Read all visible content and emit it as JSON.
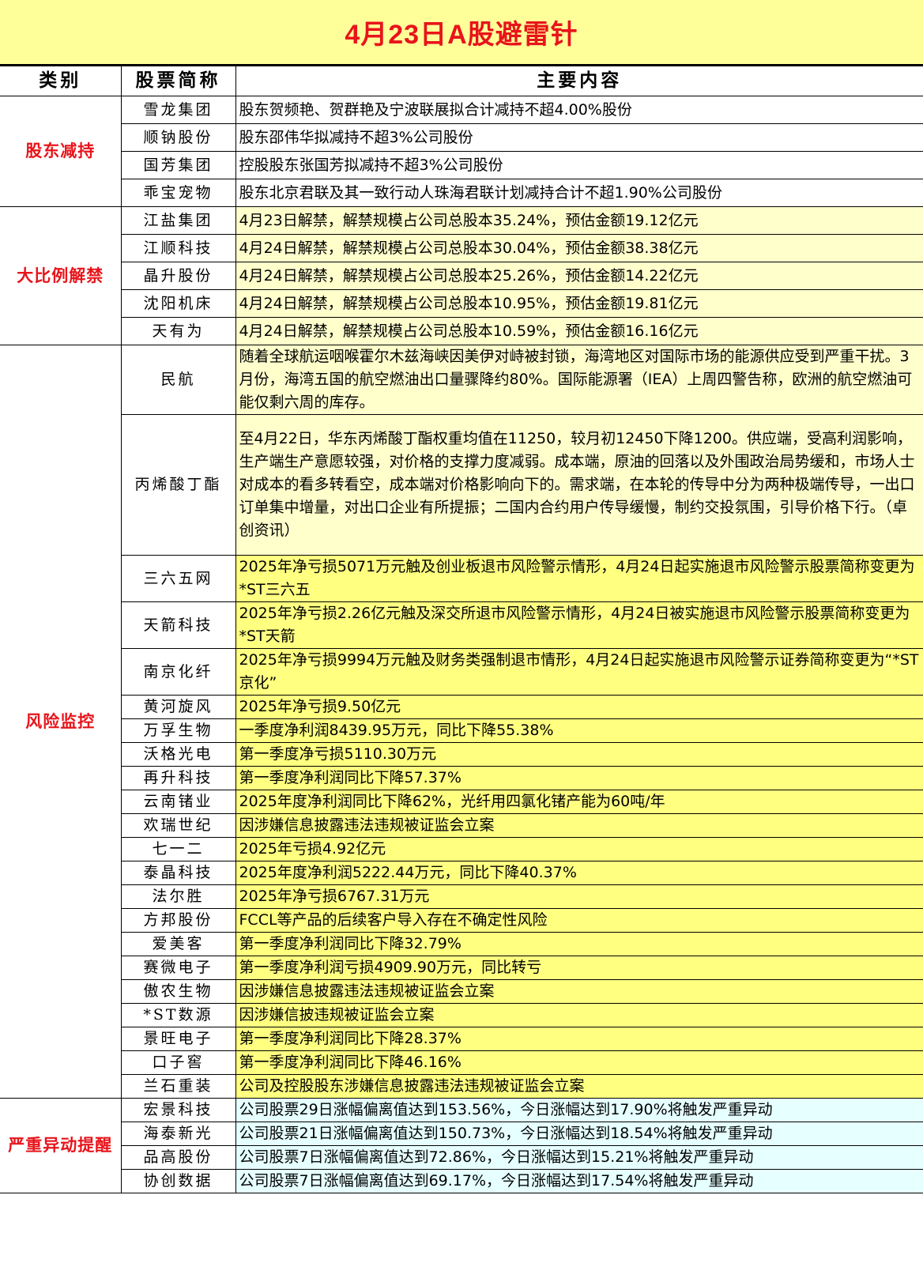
{
  "title": "4月23日A股避雷针",
  "headers": {
    "category": "类别",
    "stock": "股票简称",
    "content": "主要内容"
  },
  "groups": [
    {
      "category": "股东减持",
      "rows": [
        {
          "stock": "雪龙集团",
          "content": "股东贺频艳、贺群艳及宁波联展拟合计减持不超4.00%股份"
        },
        {
          "stock": "顺钠股份",
          "content": "股东邵伟华拟减持不超3%公司股份"
        },
        {
          "stock": "国芳集团",
          "content": "控股股东张国芳拟减持不超3%公司股份"
        },
        {
          "stock": "乖宝宠物",
          "content": "股东北京君联及其一致行动人珠海君联计划减持合计不超1.90%公司股份"
        }
      ]
    },
    {
      "category": "大比例解禁",
      "rows": [
        {
          "stock": "江盐集团",
          "content": "4月23日解禁，解禁规模占公司总股本35.24%，预估金额19.12亿元"
        },
        {
          "stock": "江顺科技",
          "content": "4月24日解禁，解禁规模占公司总股本30.04%，预估金额38.38亿元"
        },
        {
          "stock": "晶升股份",
          "content": "4月24日解禁，解禁规模占公司总股本25.26%，预估金额14.22亿元"
        },
        {
          "stock": "沈阳机床",
          "content": "4月24日解禁，解禁规模占公司总股本10.95%，预估金额19.81亿元"
        },
        {
          "stock": "天有为",
          "content": "4月24日解禁，解禁规模占公司总股本10.59%，预估金额16.16亿元"
        }
      ]
    },
    {
      "category": "风险监控",
      "rows": [
        {
          "stock": "民航",
          "content": "随着全球航运咽喉霍尔木兹海峡因美伊对峙被封锁，海湾地区对国际市场的能源供应受到严重干扰。3月份，海湾五国的航空燃油出口量骤降约80%。国际能源署（IEA）上周四警告称，欧洲的航空燃油可能仅剩六周的库存。"
        },
        {
          "stock": "丙烯酸丁酯",
          "content": "至4月22日，华东丙烯酸丁酯权重均值在11250，较月初12450下降1200。供应端，受高利润影响，生产端生产意愿较强，对价格的支撑力度减弱。成本端，原油的回落以及外围政治局势缓和，市场人士对成本的看多转看空，成本端对价格影响向下的。需求端，在本轮的传导中分为两种极端传导，一出口订单集中增量，对出口企业有所提振；二国内合约用户传导缓慢，制约交投氛围，引导价格下行。（卓创资讯）"
        },
        {
          "stock": "三六五网",
          "content": "2025年净亏损5071万元触及创业板退市风险警示情形，4月24日起实施退市风险警示股票简称变更为*ST三六五"
        },
        {
          "stock": "天箭科技",
          "content": "2025年净亏损2.26亿元触及深交所退市风险警示情形，4月24日被实施退市风险警示股票简称变更为*ST天箭"
        },
        {
          "stock": "南京化纤",
          "content": "2025年净亏损9994万元触及财务类强制退市情形，4月24日起实施退市风险警示证券简称变更为“*ST京化”"
        },
        {
          "stock": "黄河旋风",
          "content": "2025年净亏损9.50亿元"
        },
        {
          "stock": "万孚生物",
          "content": "一季度净利润8439.95万元，同比下降55.38%"
        },
        {
          "stock": "沃格光电",
          "content": "第一季度净亏损5110.30万元"
        },
        {
          "stock": "再升科技",
          "content": "第一季度净利润同比下降57.37%"
        },
        {
          "stock": "云南锗业",
          "content": "2025年度净利润同比下降62%，光纤用四氯化锗产能为60吨/年"
        },
        {
          "stock": "欢瑞世纪",
          "content": "因涉嫌信息披露违法违规被证监会立案"
        },
        {
          "stock": "七一二",
          "content": "2025年亏损4.92亿元"
        },
        {
          "stock": "泰晶科技",
          "content": "2025年度净利润5222.44万元，同比下降40.37%"
        },
        {
          "stock": "法尔胜",
          "content": "2025年净亏损6767.31万元"
        },
        {
          "stock": "方邦股份",
          "content": "FCCL等产品的后续客户导入存在不确定性风险"
        },
        {
          "stock": "爱美客",
          "content": "第一季度净利润同比下降32.79%"
        },
        {
          "stock": "赛微电子",
          "content": "第一季度净利润亏损4909.90万元，同比转亏"
        },
        {
          "stock": "傲农生物",
          "content": "因涉嫌信息披露违法违规被证监会立案"
        },
        {
          "stock": "*ST数源",
          "content": "因涉嫌信披违规被证监会立案"
        },
        {
          "stock": "景旺电子",
          "content": "第一季度净利润同比下降28.37%"
        },
        {
          "stock": "口子窖",
          "content": "第一季度净利润同比下降46.16%"
        },
        {
          "stock": "兰石重装",
          "content": "公司及控股股东涉嫌信息披露违法违规被证监会立案"
        }
      ]
    },
    {
      "category": "严重异动提醒",
      "rows": [
        {
          "stock": "宏景科技",
          "content": "公司股票29日涨幅偏离值达到153.56%，今日涨幅达到17.90%将触发严重异动"
        },
        {
          "stock": "海泰新光",
          "content": "公司股票21日涨幅偏离值达到150.73%，今日涨幅达到18.54%将触发严重异动"
        },
        {
          "stock": "品高股份",
          "content": "公司股票7日涨幅偏离值达到72.86%，今日涨幅达到15.21%将触发严重异动"
        },
        {
          "stock": "协创数据",
          "content": "公司股票7日涨幅偏离值达到69.17%，今日涨幅达到17.54%将触发严重异动"
        }
      ]
    }
  ]
}
